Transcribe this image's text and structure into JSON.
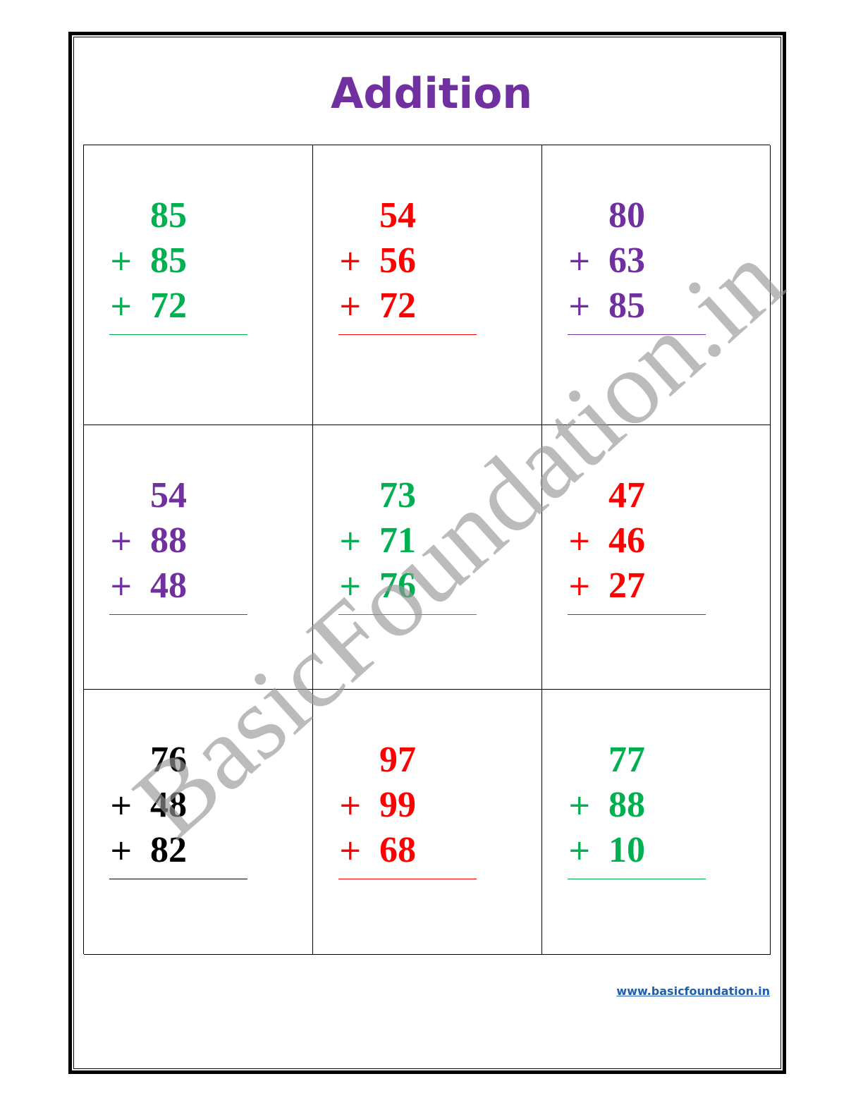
{
  "title": "Addition",
  "watermark": "BasicFoundation.in",
  "footer_link": "www.basicfoundation.in",
  "colors": {
    "title": "#7030a0",
    "green": "#00b050",
    "red": "#ff0000",
    "purple": "#7030a0",
    "black": "#000000",
    "watermark": "#969696",
    "link": "#1f5fae"
  },
  "operator": "+",
  "problems": [
    {
      "numbers": [
        "85",
        "85",
        "72"
      ],
      "color": "#00b050"
    },
    {
      "numbers": [
        "54",
        "56",
        "72"
      ],
      "color": "#ff0000"
    },
    {
      "numbers": [
        "80",
        "63",
        "85"
      ],
      "color": "#7030a0"
    },
    {
      "numbers": [
        "54",
        "88",
        "48"
      ],
      "color": "#7030a0"
    },
    {
      "numbers": [
        "73",
        "71",
        "76"
      ],
      "color": "#00b050"
    },
    {
      "numbers": [
        "47",
        "46",
        "27"
      ],
      "color": "#ff0000"
    },
    {
      "numbers": [
        "76",
        "48",
        "82"
      ],
      "color": "#000000"
    },
    {
      "numbers": [
        "97",
        "99",
        "68"
      ],
      "color": "#ff0000"
    },
    {
      "numbers": [
        "77",
        "88",
        "10"
      ],
      "color": "#00b050"
    }
  ]
}
